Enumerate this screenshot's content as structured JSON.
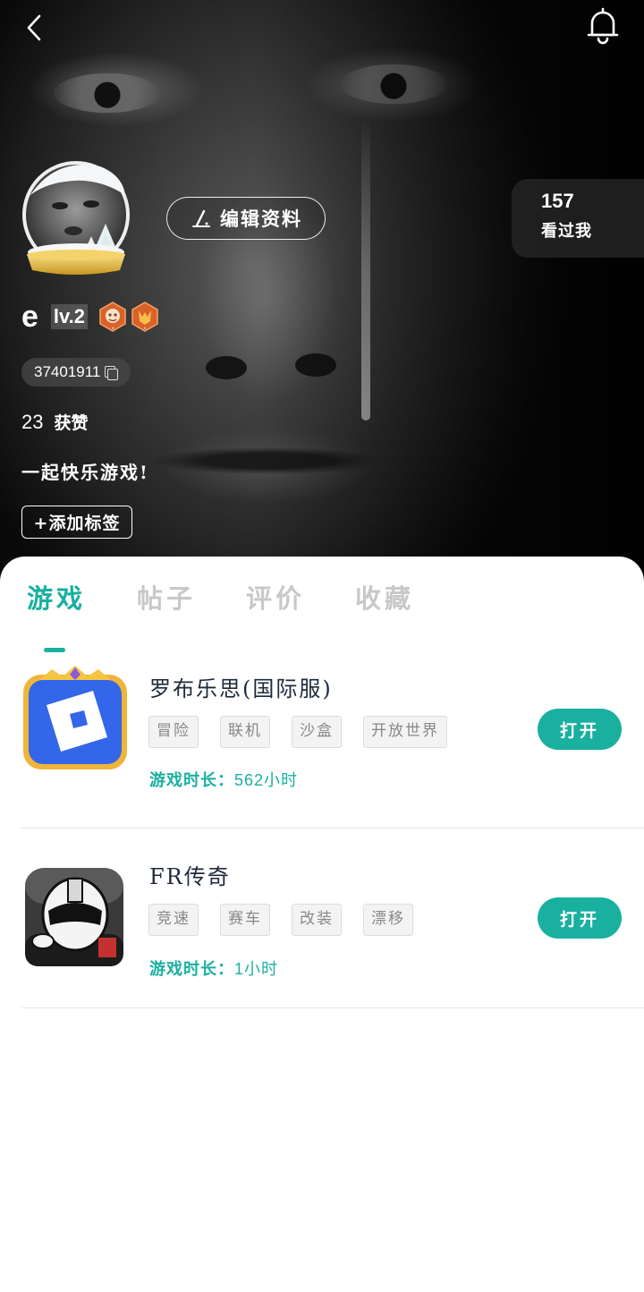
{
  "header": {
    "back_icon": "chevron-left-icon",
    "bell_icon": "bell-icon",
    "edit_profile_label": "编辑资料",
    "visitors": {
      "count": "157",
      "label": "看过我"
    }
  },
  "profile": {
    "username": "e",
    "level": "lv.2",
    "uid": "37401911",
    "likes_count": "23",
    "likes_label": "获赞",
    "bio": "一起快乐游戏!",
    "add_tag_label": "+添加标签"
  },
  "tabs": [
    {
      "label": "游戏",
      "active": true
    },
    {
      "label": "帖子",
      "active": false
    },
    {
      "label": "评价",
      "active": false
    },
    {
      "label": "收藏",
      "active": false
    }
  ],
  "games": [
    {
      "title": "罗布乐思(国际服)",
      "tags": [
        "冒险",
        "联机",
        "沙盒",
        "开放世界"
      ],
      "playtime_label": "游戏时长：",
      "playtime_value": "562小时",
      "open_label": "打开"
    },
    {
      "title": "FR传奇",
      "tags": [
        "竞速",
        "赛车",
        "改装",
        "漂移"
      ],
      "playtime_label": "游戏时长：",
      "playtime_value": "1小时",
      "open_label": "打开"
    }
  ],
  "colors": {
    "accent": "#19b0a0",
    "tab_inactive": "#c8c8c8",
    "title": "#1e2a3a"
  }
}
